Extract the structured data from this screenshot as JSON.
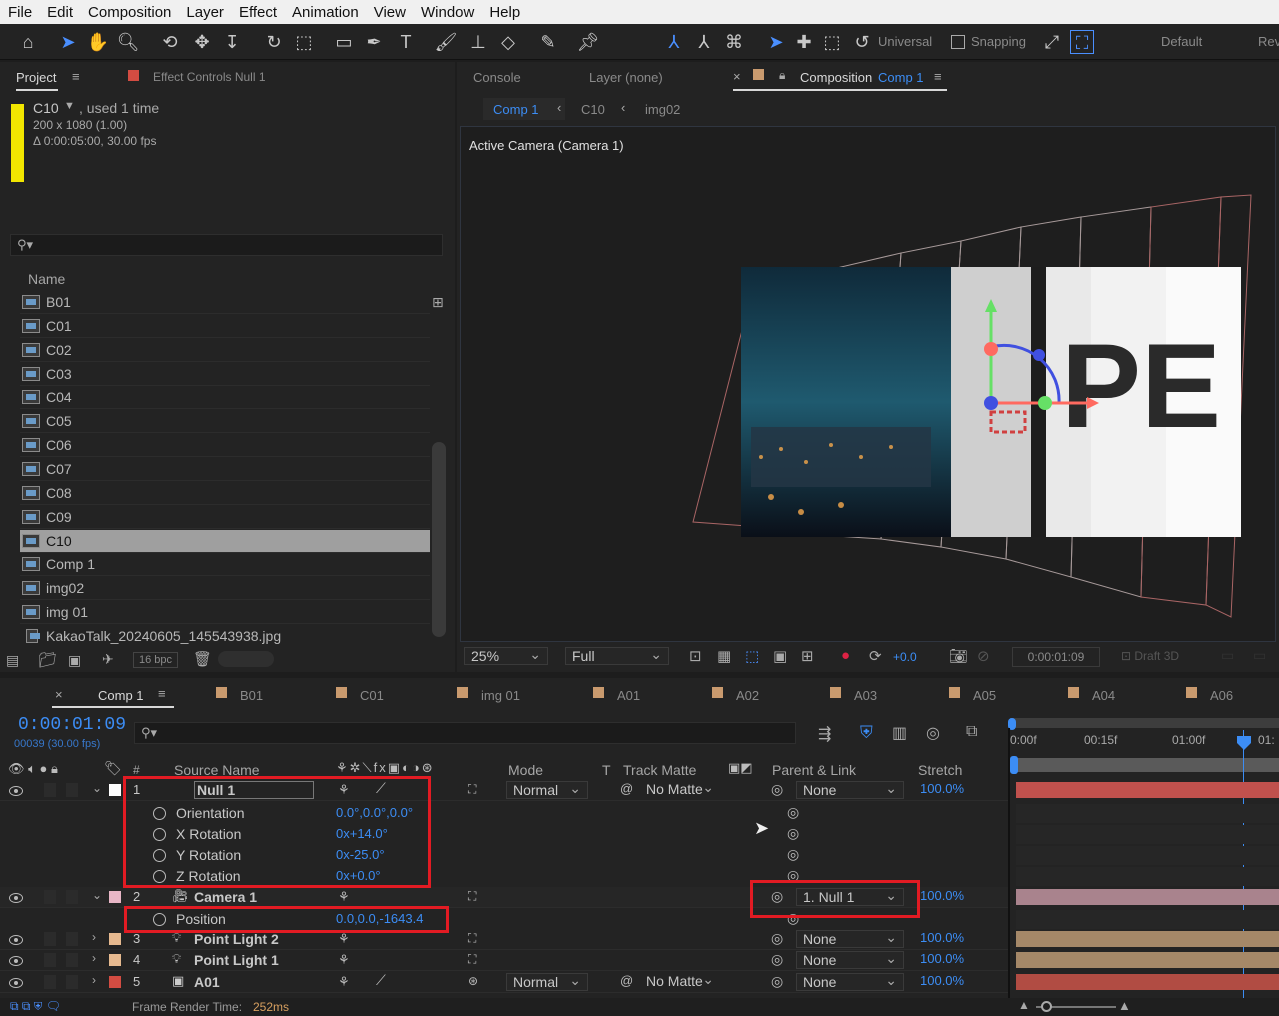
{
  "menu": [
    "File",
    "Edit",
    "Composition",
    "Layer",
    "Effect",
    "Animation",
    "View",
    "Window",
    "Help"
  ],
  "toolbar": {
    "axis_mode": "Universal",
    "snapping": "Snapping",
    "workspace_default": "Default",
    "workspace_rev": "Rev"
  },
  "project_panel": {
    "tab_project": "Project",
    "tab_effect_controls": "Effect Controls Null 1",
    "item_name": "C10",
    "usage": ", used 1 time",
    "dimensions": "200 x 1080 (1.00)",
    "duration": "Δ 0:00:05:00, 30.00 fps",
    "column_name": "Name",
    "items": [
      "B01",
      "C01",
      "C02",
      "C03",
      "C04",
      "C05",
      "C06",
      "C07",
      "C08",
      "C09",
      "C10",
      "Comp 1",
      "img02",
      "img 01",
      "KakaoTalk_20240605_145543938.jpg"
    ],
    "selected_item": "C10",
    "bpc": "16 bpc"
  },
  "comp_panel": {
    "tab_console": "Console",
    "tab_layer": "Layer (none)",
    "tab_composition": "Composition",
    "tab_comp_name": "Comp 1",
    "breadcrumbs": [
      "Comp 1",
      "C10",
      "img02"
    ],
    "camera_label": "Active Camera (Camera 1)",
    "zoom": "25%",
    "resolution": "Full",
    "exposure": "+0.0",
    "timecode": "0:00:01:09",
    "draft3d": "Draft 3D"
  },
  "timeline": {
    "tabs": [
      "Comp 1",
      "B01",
      "C01",
      "img 01",
      "A01",
      "A02",
      "A03",
      "A05",
      "A04",
      "A06"
    ],
    "tab_colors": [
      "",
      "#c99a6e",
      "#c99a6e",
      "#c99a6e",
      "#c99a6e",
      "#c99a6e",
      "#c99a6e",
      "#c99a6e",
      "#c99a6e",
      "#c99a6e"
    ],
    "current_time": "0:00:01:09",
    "frame_info": "00039 (30.00 fps)",
    "columns": {
      "num": "#",
      "source": "Source Name",
      "mode": "Mode",
      "t": "T",
      "track_matte": "Track Matte",
      "parent": "Parent & Link",
      "stretch": "Stretch"
    },
    "ruler": [
      "0:00f",
      "00:15f",
      "01:00f",
      "01:"
    ],
    "layers": [
      {
        "num": "1",
        "name": "Null 1",
        "mode": "Normal",
        "matte": "No Matte",
        "parent": "None",
        "stretch": "100.0%",
        "color": "#ffffff",
        "bar_color": "#c0514d"
      },
      {
        "num": "2",
        "name": "Camera 1",
        "parent": "1. Null 1",
        "stretch": "100.0%",
        "color": "#e8b6c6",
        "bar_color": "#a9838d"
      },
      {
        "num": "3",
        "name": "Point Light 2",
        "parent": "None",
        "stretch": "100.0%",
        "color": "#e6b98f",
        "bar_color": "#a58868"
      },
      {
        "num": "4",
        "name": "Point Light 1",
        "parent": "None",
        "stretch": "100.0%",
        "color": "#e6b98f",
        "bar_color": "#a58868"
      },
      {
        "num": "5",
        "name": "A01",
        "mode": "Normal",
        "matte": "No Matte",
        "parent": "None",
        "stretch": "100.0%",
        "color": "#d34c42",
        "bar_color": "#b14c43"
      }
    ],
    "null_props": [
      {
        "name": "Orientation",
        "value": "0.0°,0.0°,0.0°"
      },
      {
        "name": "X Rotation",
        "value": "0x+14.0°"
      },
      {
        "name": "Y Rotation",
        "value": "0x-25.0°"
      },
      {
        "name": "Z Rotation",
        "value": "0x+0.0°"
      }
    ],
    "camera_props": [
      {
        "name": "Position",
        "value": "0.0,0.0,-1643.4"
      }
    ],
    "status": "Frame Render Time:",
    "render_time": "252ms"
  },
  "colors": {
    "accent": "#3c8df5",
    "highlight_box": "#e21b23"
  }
}
